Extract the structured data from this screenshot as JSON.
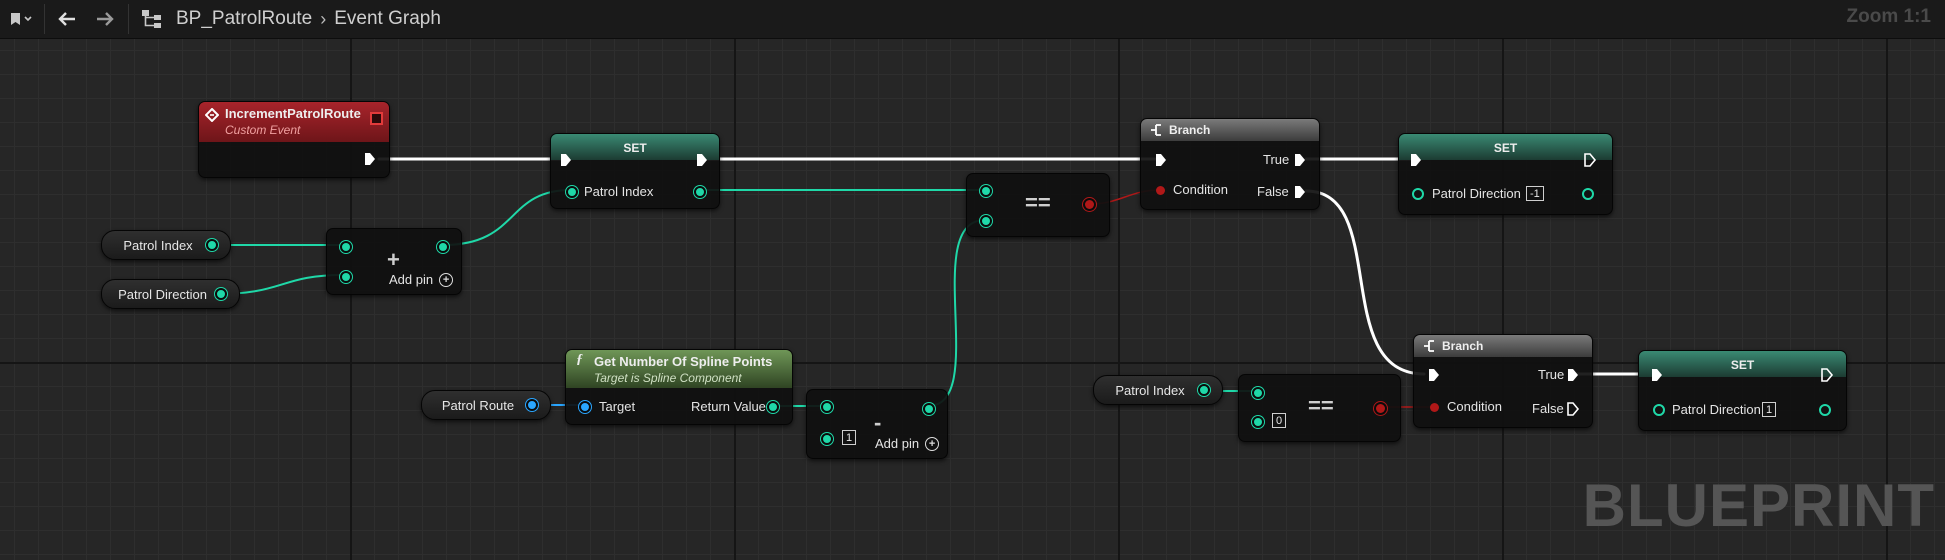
{
  "toolbar": {
    "back_icon": "arrow-left-icon",
    "forward_icon": "arrow-right-icon",
    "graph_icon": "graph-tree-icon",
    "breadcrumb": {
      "blueprint": "BP_PatrolRoute",
      "graph": "Event Graph"
    },
    "zoom_label": "Zoom 1:1"
  },
  "watermark": "BLUEPRINT",
  "colors": {
    "exec": "#ffffff",
    "integer": "#1fd8a8",
    "object": "#2aa6ff",
    "boolean": "#b01818",
    "event_header": "#8e1d22",
    "set_header": "#2e6d5b",
    "function_header": "#5c7a4a"
  },
  "nodes": {
    "custom_event": {
      "title": "IncrementPatrolRoute",
      "subtitle": "Custom Event"
    },
    "set1": {
      "title": "SET",
      "pin": "Patrol Index"
    },
    "get_patrol_index_1": {
      "label": "Patrol Index"
    },
    "get_patrol_direction": {
      "label": "Patrol Direction"
    },
    "add": {
      "op": "+",
      "add_pin": "Add pin"
    },
    "get_num_spline": {
      "title": "Get Number Of Spline Points",
      "subtitle": "Target is Spline Component",
      "target": "Target",
      "return": "Return Value"
    },
    "get_patrol_route": {
      "label": "Patrol Route"
    },
    "subtract": {
      "op": "-",
      "value": "1",
      "add_pin": "Add pin"
    },
    "equal1": {
      "op": "=="
    },
    "branch1": {
      "title": "Branch",
      "condition": "Condition",
      "true": "True",
      "false": "False"
    },
    "set2": {
      "title": "SET",
      "pin": "Patrol Direction",
      "value": "-1"
    },
    "get_patrol_index_2": {
      "label": "Patrol Index"
    },
    "equal2": {
      "op": "==",
      "value": "0"
    },
    "branch2": {
      "title": "Branch",
      "condition": "Condition",
      "true": "True",
      "false": "False"
    },
    "set3": {
      "title": "SET",
      "pin": "Patrol Direction",
      "value": "1"
    }
  }
}
